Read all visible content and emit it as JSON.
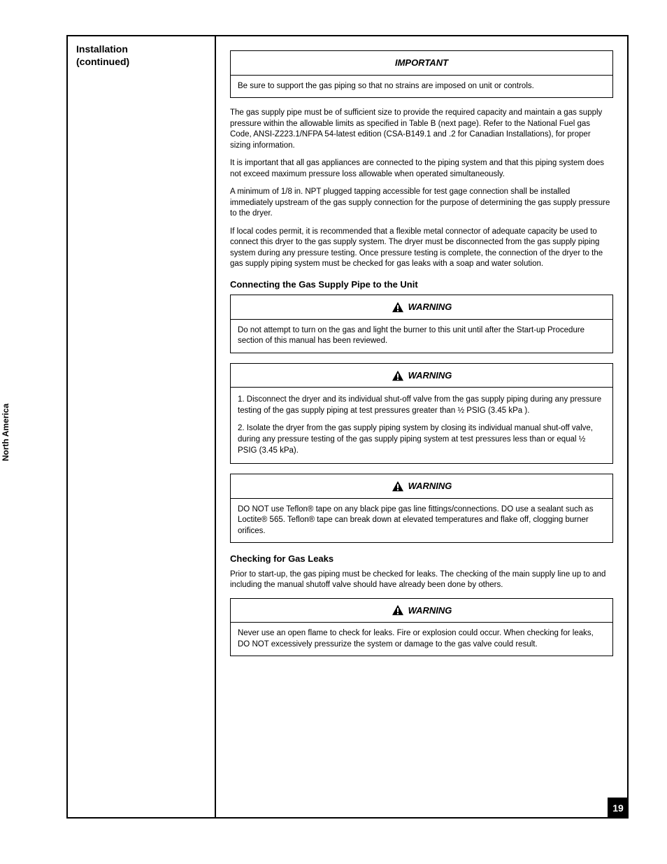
{
  "sideTag": "North America",
  "pageNumber": "19",
  "sidebar": {
    "title": "Installation",
    "subtitle": "(continued)"
  },
  "topBox": {
    "header": "IMPORTANT",
    "body": "Be sure to support the gas piping so that no strains are imposed on unit or controls."
  },
  "paragraphs": {
    "p1": "The gas supply pipe must be of sufficient size to provide the required capacity and maintain a gas supply pressure within the allowable limits as specified in Table B (next page). Refer to the National Fuel gas Code, ANSI-Z223.1/NFPA 54-latest edition (CSA-B149.1 and .2 for Canadian Installations), for proper sizing information.",
    "p2": "It is important that all gas appliances are connected to the piping system and that this piping system does not exceed maximum pressure loss allowable when operated simultaneously.",
    "p3": "A minimum of 1/8 in. NPT plugged tapping accessible for test gage connection shall be installed immediately upstream of the gas supply connection for the purpose of determining the gas supply pressure to the dryer.",
    "p4": "If local codes permit, it is recommended that a flexible metal connector of adequate capacity be used to connect this dryer to the gas supply system. The dryer must be disconnected from the gas supply piping system during any pressure testing. Once pressure testing is complete, the connection of the dryer to the gas supply piping system must be checked for gas leaks with a soap and water solution."
  },
  "connectingHeading": "Connecting the Gas Supply Pipe to the Unit",
  "warn1": {
    "header": "WARNING",
    "body": "Do not attempt to turn on the gas and light the burner to this unit until after the Start-up Procedure section of this manual has been reviewed."
  },
  "warn2": {
    "header": "WARNING",
    "l1": "1. Disconnect the dryer and its individual shut-off valve from the gas supply piping during any pressure testing of the gas supply piping at test pressures greater than ½ PSIG (3.45 kPa ).",
    "l2": "2. Isolate the dryer from the gas supply piping system by closing its individual manual shut-off valve, during any pressure testing of the gas supply piping system at test pressures less than or equal ½ PSIG (3.45 kPa)."
  },
  "warn3": {
    "header": "WARNING",
    "body": "DO NOT use Teflon® tape on any black pipe gas line fittings/connections. DO use a sealant such as Loctite® 565. Teflon® tape can break down at elevated temperatures and flake off, clogging burner orifices."
  },
  "leakHeading": "Checking for Gas Leaks",
  "leakPara": "Prior to start-up, the gas piping must be checked for leaks. The checking of the main supply line up to and including the manual shutoff valve should have already been done by others.",
  "warn4": {
    "header": "WARNING",
    "body": "Never use an open flame to check for leaks. Fire or explosion could occur. When checking for leaks, DO NOT excessively pressurize the system or damage to the gas valve could result."
  }
}
